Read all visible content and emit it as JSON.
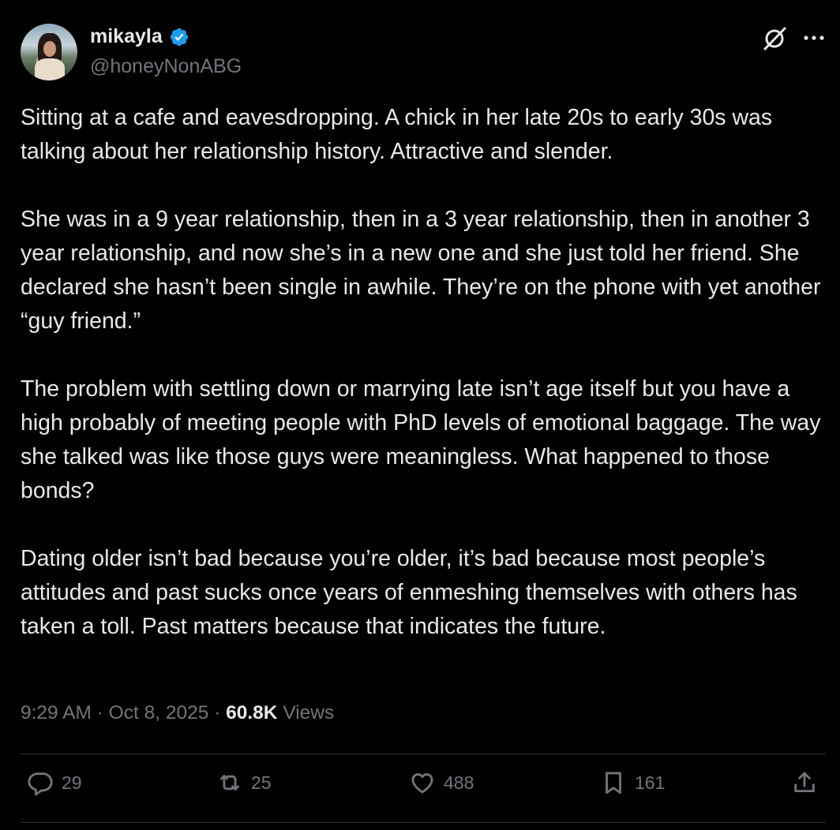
{
  "author": {
    "name": "mikayla",
    "handle": "@honeyNonABG",
    "verified": true,
    "verified_color": "#1d9bf0"
  },
  "header_icons": [
    "grok-icon",
    "more-icon"
  ],
  "tweet": {
    "paragraphs": [
      "Sitting at a cafe and eavesdropping. A chick in her late 20s to early 30s was talking about her relationship history. Attractive and slender.",
      "She was in a 9 year relationship, then in a 3 year relationship, then in another 3 year relationship, and now she’s in a new one and she just told her friend. She declared she hasn’t been single in awhile. They’re on the phone with yet another “guy friend.”",
      "The problem with settling down or marrying late isn’t age itself but you have a high probably of meeting people with PhD levels of emotional baggage. The way she talked was like those guys were meaningless. What happened to those bonds?",
      "Dating older isn’t bad because you’re older, it’s bad because most people’s attitudes and past sucks once years of enmeshing themselves with others has taken a toll. Past matters because that indicates the future."
    ]
  },
  "meta": {
    "time": "9:29 AM",
    "separator": " · ",
    "date": "Oct 8, 2025",
    "views_count": "60.8K",
    "views_label": " Views"
  },
  "actions": {
    "replies": "29",
    "reposts": "25",
    "likes": "488",
    "bookmarks": "161"
  },
  "colors": {
    "background": "#000000",
    "text": "#e7e9ea",
    "secondary": "#71767b",
    "divider": "#2f3336"
  }
}
